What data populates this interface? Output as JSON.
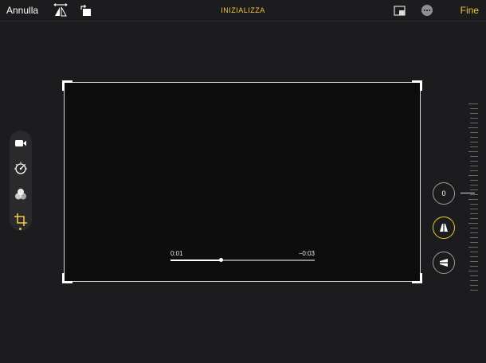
{
  "toolbar": {
    "cancel_label": "Annulla",
    "title": "INIZIALIZZA",
    "done_label": "Fine"
  },
  "player": {
    "elapsed": "0:01",
    "remaining": "−0:03",
    "progress_fraction": 0.35
  },
  "adjust": {
    "straighten_value": "0"
  },
  "colors": {
    "accent": "#f4c542",
    "background": "#1c1c1e",
    "frame_border": "#d8d8d8"
  },
  "icons": [
    "flip-icon",
    "rotate-icon",
    "aspect-ratio-icon",
    "more-icon",
    "video-camera-icon",
    "adjust-dial-icon",
    "filters-icon",
    "crop-icon",
    "vertical-perspective-icon",
    "horizontal-perspective-icon"
  ]
}
